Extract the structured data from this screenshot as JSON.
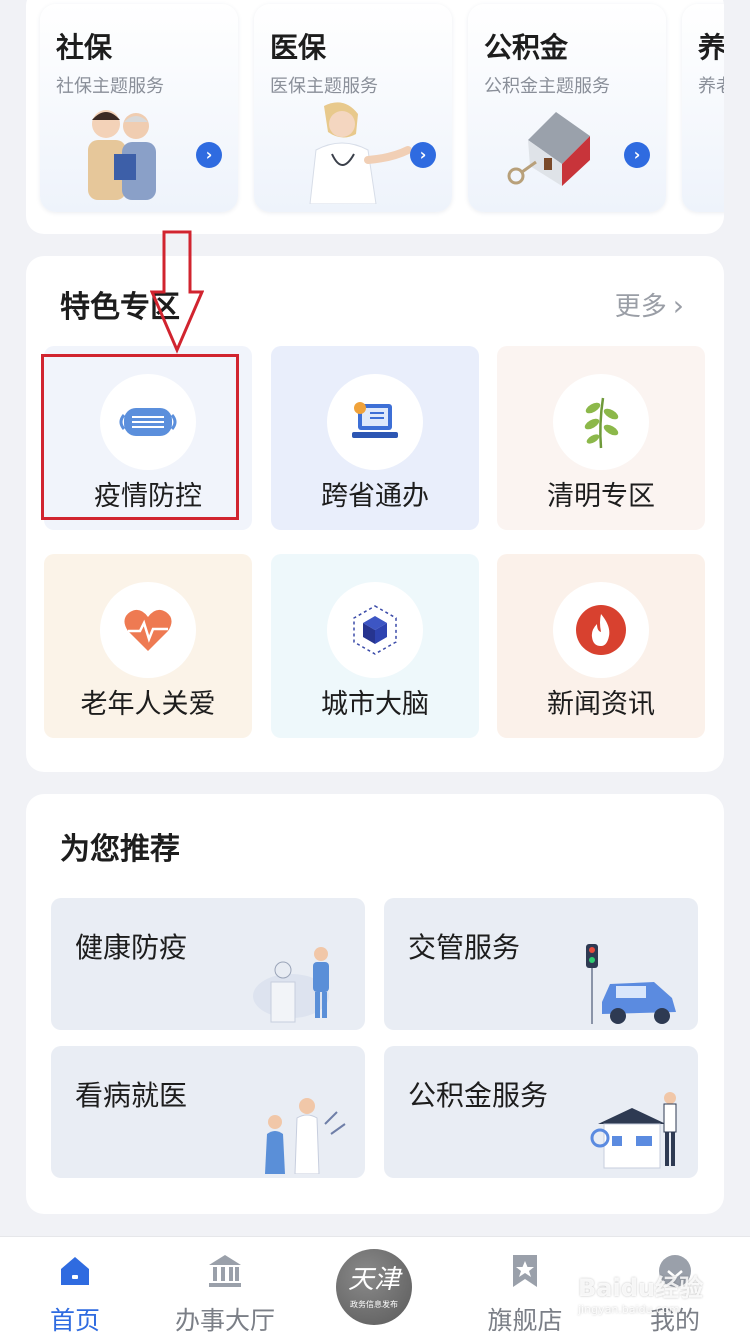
{
  "theme_cards": [
    {
      "title": "社保",
      "subtitle": "社保主题服务",
      "icon": "elderly-couple-illustration"
    },
    {
      "title": "医保",
      "subtitle": "医保主题服务",
      "icon": "doctor-illustration"
    },
    {
      "title": "公积金",
      "subtitle": "公积金主题服务",
      "icon": "house-key-illustration"
    },
    {
      "title": "养",
      "subtitle": "养老",
      "icon": "partial-card"
    }
  ],
  "featured": {
    "title": "特色专区",
    "more_label": "更多",
    "items": [
      {
        "label": "疫情防控",
        "icon": "face-mask-icon",
        "bg": "#f1f4fb"
      },
      {
        "label": "跨省通办",
        "icon": "laptop-service-icon",
        "bg": "#e9eefb"
      },
      {
        "label": "清明专区",
        "icon": "leaf-branch-icon",
        "bg": "#fbf4f1"
      },
      {
        "label": "老年人关爱",
        "icon": "heart-pulse-icon",
        "bg": "#fbf3e8"
      },
      {
        "label": "城市大脑",
        "icon": "cube-network-icon",
        "bg": "#eef8fb"
      },
      {
        "label": "新闻资讯",
        "icon": "flame-icon",
        "bg": "#fbf1ea"
      }
    ]
  },
  "recommend": {
    "title": "为您推荐",
    "items": [
      {
        "label": "健康防疫",
        "icon": "nurse-illustration"
      },
      {
        "label": "交管服务",
        "icon": "car-traffic-light-illustration"
      },
      {
        "label": "看病就医",
        "icon": "doctor-patient-illustration"
      },
      {
        "label": "公积金服务",
        "icon": "house-person-illustration"
      }
    ]
  },
  "tabbar": {
    "items": [
      {
        "label": "首页",
        "icon": "home-icon",
        "active": true
      },
      {
        "label": "办事大厅",
        "icon": "bank-hall-icon",
        "active": false
      },
      {
        "label": "天津",
        "sublabel": "政务信息发布",
        "icon": "city-logo"
      },
      {
        "label": "旗舰店",
        "icon": "bookmark-star-icon",
        "active": false
      },
      {
        "label": "我的",
        "icon": "profile-icon",
        "active": false
      }
    ],
    "active_color": "#2f6be0"
  },
  "watermark": {
    "text": "Baidu经验",
    "sub": "jingyan.baidu.com"
  },
  "annotation": {
    "color": "#d1242f"
  }
}
